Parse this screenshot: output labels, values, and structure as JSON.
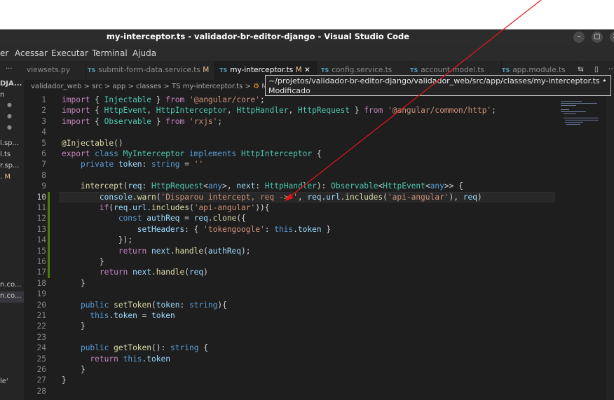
{
  "window": {
    "title": "my-interceptor.ts - validador-br-editor-django - Visual Studio Code",
    "controls": [
      "–",
      "▢",
      "✕"
    ]
  },
  "menubar": [
    "er",
    "Acessar",
    "Executar",
    "Terminal",
    "Ajuda"
  ],
  "sidebar": {
    "header": "···",
    "items": [
      "DJA...",
      "n",
      "●",
      "●",
      "●",
      "l.sp...",
      "l.ts",
      "r.sp...",
      ". M",
      "n.co...",
      "n.co...",
      "le'"
    ]
  },
  "tabs": [
    {
      "icon": "",
      "label": "viewsets.py",
      "modified": ""
    },
    {
      "icon": "TS",
      "label": "submit-form-data.service.ts",
      "modified": "M"
    },
    {
      "icon": "TS",
      "label": "my-interceptor.ts",
      "modified": "M",
      "close": "✕"
    },
    {
      "icon": "TS",
      "label": "config.service.ts",
      "modified": ""
    },
    {
      "icon": "TS",
      "label": "account.model.ts",
      "modified": ""
    },
    {
      "icon": "TS",
      "label": "app.module.ts",
      "modified": ""
    }
  ],
  "tab_actions": [
    "⇆",
    "▯",
    "···"
  ],
  "breadcrumb": [
    "validador_web",
    "src",
    "app",
    "classes",
    "TS my-interceptor.ts",
    "MyIn"
  ],
  "tooltip": {
    "path": "~/projetos/validador-br-editor-django/validador_web/src/app/classes/my-interceptor.ts •",
    "status": "Modificado"
  },
  "editor": {
    "current_line": 10,
    "lines": [
      "import { Injectable } from '@angular/core';",
      "import { HttpEvent, HttpInterceptor, HttpHandler, HttpRequest } from '@angular/common/http';",
      "import { Observable } from 'rxjs';",
      "",
      "@Injectable()",
      "export class MyInterceptor implements HttpInterceptor {",
      "    private token: string = ''",
      "",
      "    intercept(req: HttpRequest<any>, next: HttpHandler): Observable<HttpEvent<any>> {",
      "        console.warn('Disparou intercept, req -> ', req.url.includes('api-angular'), req)",
      "        if(req.url.includes('api-angular')){",
      "            const authReq = req.clone({",
      "                setHeaders: { 'tokengoogle': this.token }",
      "            });",
      "            return next.handle(authReq);",
      "        }",
      "        return next.handle(req)",
      "    }",
      "",
      "    public setToken(token: string){",
      "      this.token = token",
      "    }",
      "",
      "    public getToken(): string {",
      "      return this.token",
      "    }",
      "}",
      ""
    ]
  },
  "colors": {
    "editor_bg": "#1e1e1e",
    "keyword": "#569cd6",
    "control_keyword": "#c586c0",
    "string": "#ce9178",
    "function": "#dcdcaa",
    "variable": "#9cdcfe",
    "type": "#4ec9b0",
    "annotation_arrow": "#e8141a",
    "modified_gutter": "#487e02"
  },
  "icons": {
    "close_tab": "close-icon",
    "split_editor": "split-editor-icon",
    "compare": "compare-icon",
    "breadcrumb_class": "class-symbol-icon"
  }
}
